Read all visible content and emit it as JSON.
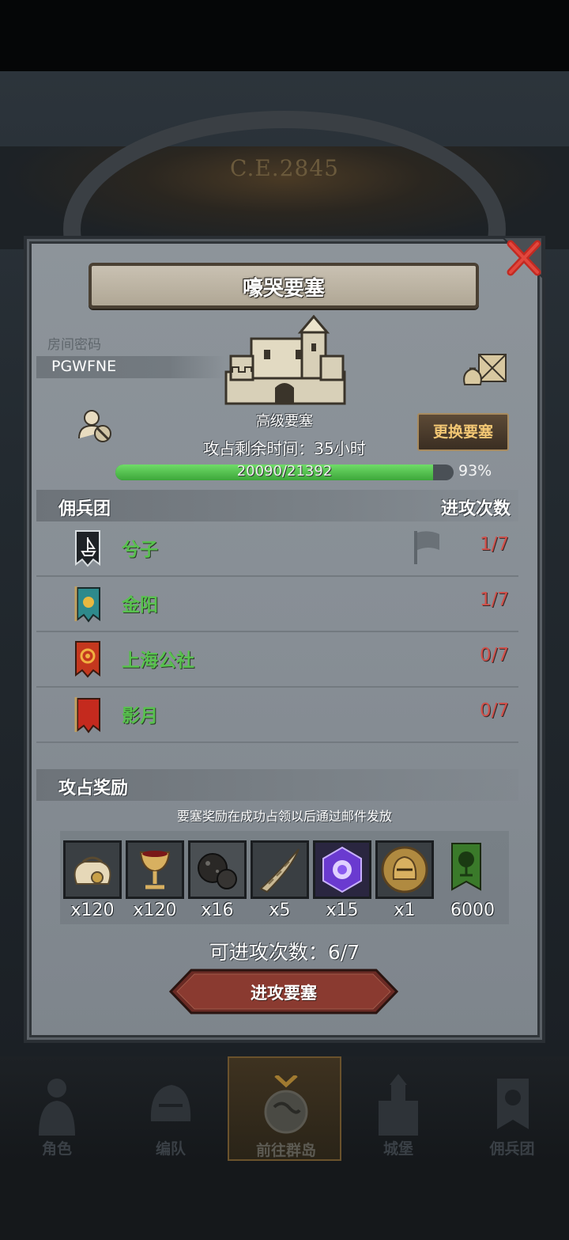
{
  "background": {
    "year": "C.E.2845"
  },
  "dialog": {
    "title": "嚎哭要塞",
    "room_label": "房间密码",
    "room_code": "PGWFNE",
    "fortress_level": "高级要塞",
    "change_button": "更换要塞",
    "time_remaining": "攻占剩余时间：35小时",
    "progress": {
      "text": "20090/21392",
      "percent_label": "93%",
      "fraction": 0.939
    },
    "mercenary_header": "佣兵团",
    "attacks_header": "进攻次数",
    "mercenaries": [
      {
        "name": "兮子",
        "count": "1/7",
        "banner": "ship-banner-icon",
        "flag": true
      },
      {
        "name": "金阳",
        "count": "1/7",
        "banner": "sun-banner-icon",
        "flag": false
      },
      {
        "name": "上海公社",
        "count": "0/7",
        "banner": "gear-banner-icon",
        "flag": false
      },
      {
        "name": "影月",
        "count": "0/7",
        "banner": "moon-banner-icon",
        "flag": false
      }
    ],
    "reward_header": "攻占奖励",
    "reward_note": "要塞奖励在成功占领以后通过邮件发放",
    "rewards": [
      {
        "icon": "coin-sack-icon",
        "count": "x120"
      },
      {
        "icon": "goblet-icon",
        "count": "x120"
      },
      {
        "icon": "ore-icon",
        "count": "x16"
      },
      {
        "icon": "horn-icon",
        "count": "x5"
      },
      {
        "icon": "rune-gem-icon",
        "count": "x15"
      },
      {
        "icon": "knight-helmet-icon",
        "count": "x1"
      },
      {
        "icon": "tree-banner-icon",
        "count": "6000"
      }
    ],
    "attempts": "可进攻次数：6/7",
    "attack_button": "进攻要塞"
  },
  "nav": {
    "items": [
      {
        "label": "角色",
        "icon": "knight-icon",
        "active": false
      },
      {
        "label": "编队",
        "icon": "helmet-icon",
        "active": false
      },
      {
        "label": "前往群岛",
        "icon": "globe-icon",
        "active": true
      },
      {
        "label": "城堡",
        "icon": "castle-icon",
        "active": false
      },
      {
        "label": "佣兵团",
        "icon": "mercenary-icon",
        "active": false
      }
    ]
  },
  "colors": {
    "green_name": "#58c14e",
    "red_count": "#d0504a",
    "gold_button": "#f3c774",
    "progress_green": "#3da63a"
  }
}
